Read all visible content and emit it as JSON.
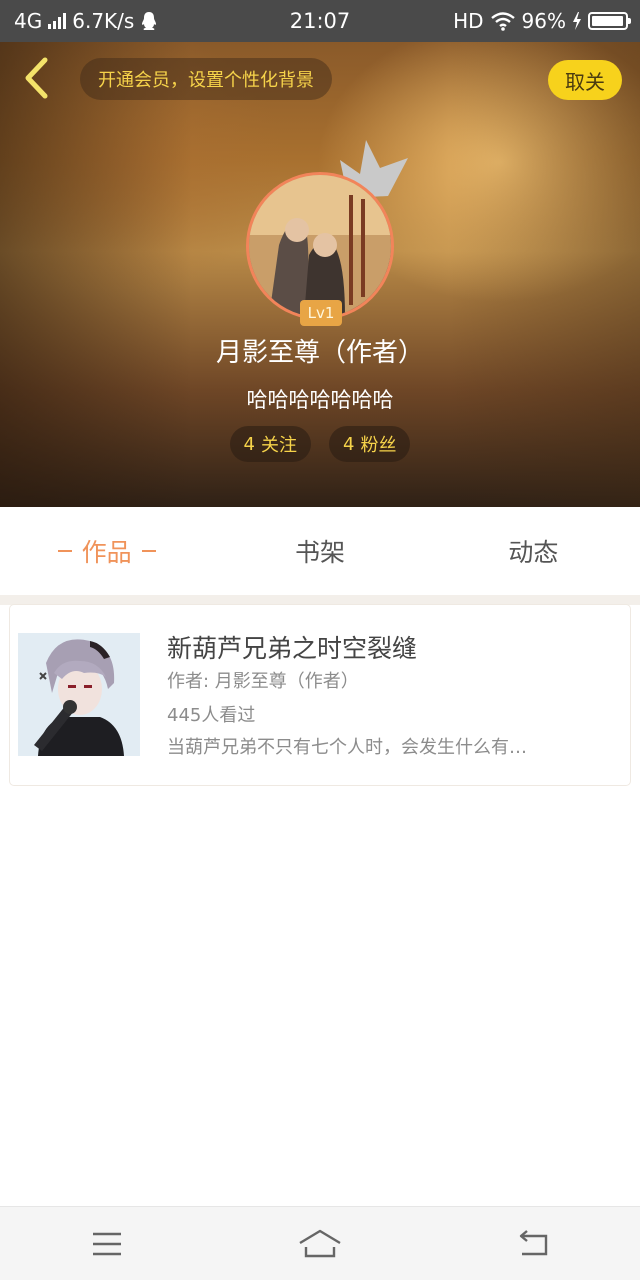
{
  "status_bar": {
    "network": "4G",
    "speed": "6.7K/s",
    "time": "21:07",
    "hd": "HD",
    "battery": "96%",
    "battery_level": 0.96
  },
  "header": {
    "vip_banner": "开通会员，设置个性化背景",
    "unfollow_label": "取关",
    "level": "Lv1",
    "name": "月影至尊（作者）",
    "bio": "哈哈哈哈哈哈哈",
    "following_count": "4",
    "following_label": "关注",
    "followers_count": "4",
    "followers_label": "粉丝",
    "accent_color": "#f7d21c"
  },
  "tabs": [
    {
      "label": "作品",
      "active": true
    },
    {
      "label": "书架",
      "active": false
    },
    {
      "label": "动态",
      "active": false
    }
  ],
  "works": [
    {
      "title": "新葫芦兄弟之时空裂缝",
      "author": "作者: 月影至尊（作者）",
      "views": "445人看过",
      "description": "当葫芦兄弟不只有七个人时，会发生什么有…"
    }
  ],
  "nav_bar": {
    "items": [
      "menu-icon",
      "home-icon",
      "back-icon"
    ]
  },
  "colors": {
    "tab_active": "#f0935a",
    "status_bar_bg": "#4a4a4a"
  }
}
